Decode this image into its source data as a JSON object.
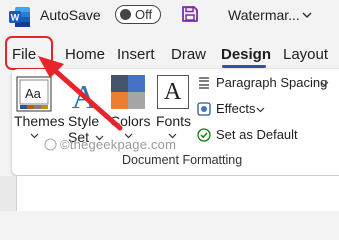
{
  "titlebar": {
    "autosave_label": "AutoSave",
    "autosave_state": "Off",
    "document_title": "Watermar..."
  },
  "tabs": [
    {
      "label": "File"
    },
    {
      "label": "Home"
    },
    {
      "label": "Insert"
    },
    {
      "label": "Draw"
    },
    {
      "label": "Design",
      "active": true
    },
    {
      "label": "Layout"
    }
  ],
  "ribbon": {
    "themes_label": "Themes",
    "themes_icon_text": "Aa",
    "style_set_line1": "Style",
    "style_set_line2": "Set",
    "colors_label": "Colors",
    "fonts_label": "Fonts",
    "fonts_icon_text": "A",
    "paragraph_spacing_label": "Paragraph Spacing",
    "effects_label": "Effects",
    "set_default_label": "Set as Default",
    "group_label": "Document Formatting"
  },
  "watermark_text": "©thegeekpage.com",
  "colors": {
    "accent": "#2b5797",
    "highlight_red": "#e8232b",
    "word_blue": "#185abd"
  }
}
